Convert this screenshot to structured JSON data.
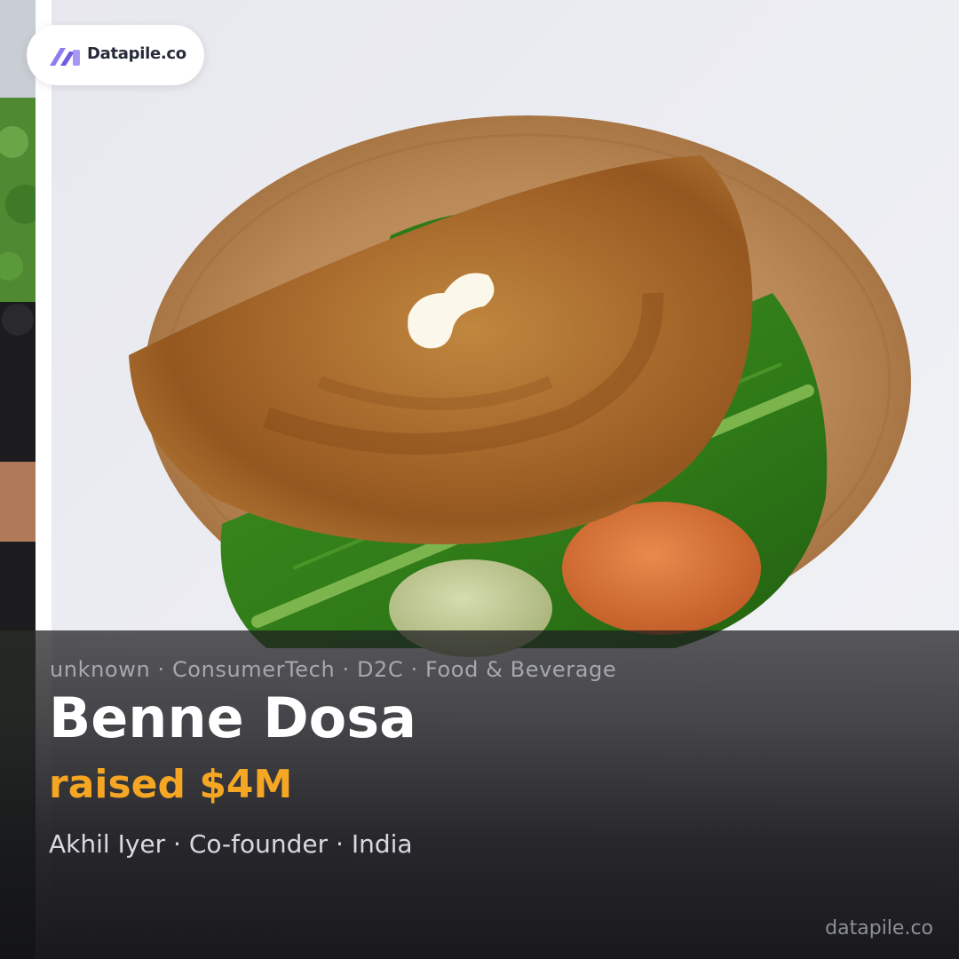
{
  "brand": {
    "logo_text": "Datapile.co",
    "watermark": "datapile.co",
    "logo_colors": [
      "#8e7cf0",
      "#5a48c8"
    ]
  },
  "story": {
    "tags": "unknown · ConsumerTech · D2C · Food & Beverage",
    "company": "Benne Dosa",
    "raised": "raised $4M",
    "byline": "Akhil Iyer · Co-founder · India"
  },
  "colors": {
    "accent": "#f5a623",
    "headline": "#ffffff",
    "tags": "#a6a8ad",
    "byline": "#d8dae0"
  },
  "photo": {
    "subject": "dosa-on-banana-leaf"
  }
}
